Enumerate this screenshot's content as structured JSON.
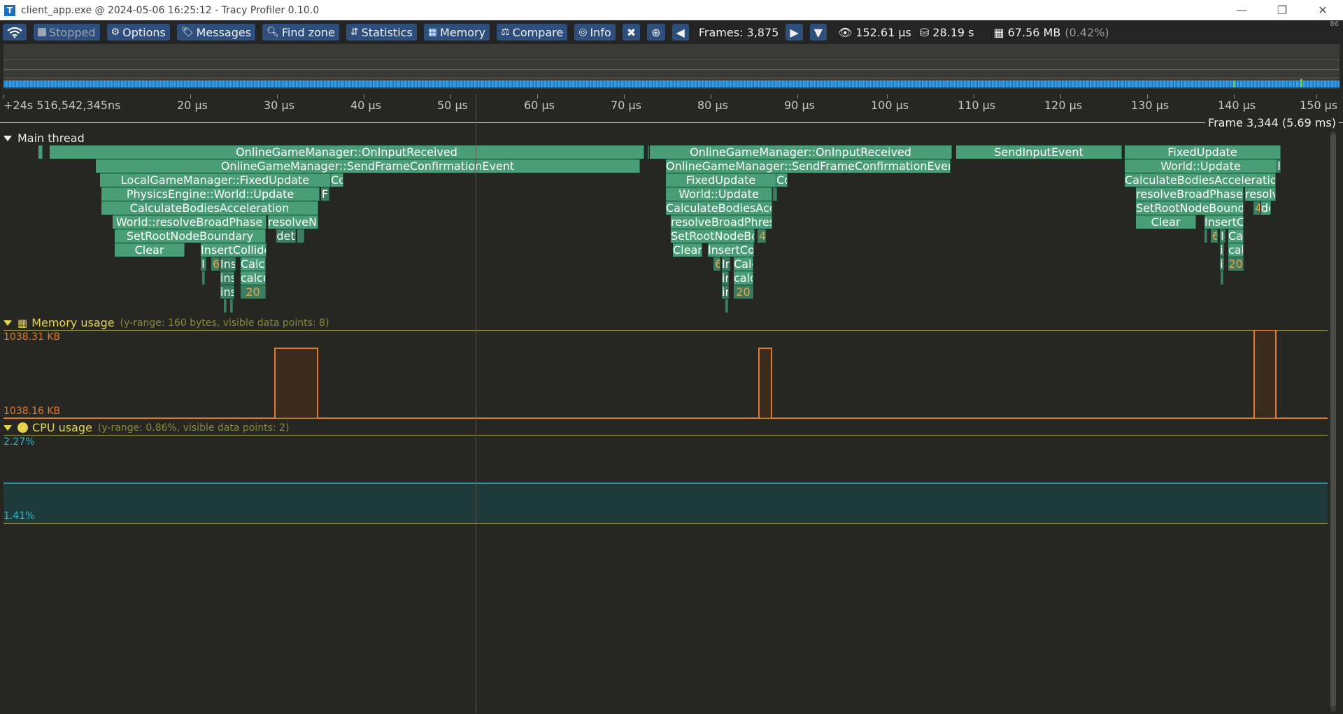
{
  "window": {
    "title": "client_app.exe @ 2024-05-06 16:25:12 - Tracy Profiler 0.10.0",
    "app_icon": "T",
    "controls": [
      "minimize",
      "maximize",
      "close"
    ]
  },
  "toolbar": {
    "connection_icon": "wifi-icon",
    "stopped_label": "Stopped",
    "options_label": "Options",
    "messages_label": "Messages",
    "find_zone_label": "Find zone",
    "statistics_label": "Statistics",
    "memory_label": "Memory",
    "compare_label": "Compare",
    "info_label": "Info",
    "frames_label": "Frames: 3,875",
    "view_time": "152.61 μs",
    "total_time": "28.19 s",
    "memory_used": "67.56 MB",
    "memory_pct": "(0.42%)",
    "corner_number": "86"
  },
  "timeline": {
    "ticks": [
      "+24s 516,542,345ns",
      "20 μs",
      "30 μs",
      "40 μs",
      "50 μs",
      "60 μs",
      "70 μs",
      "80 μs",
      "90 μs",
      "100 μs",
      "110 μs",
      "120 μs",
      "130 μs",
      "140 μs",
      "150 μs"
    ],
    "frame_label": "Frame 3,344 (5.69 ms)"
  },
  "main_thread": {
    "label": "Main thread",
    "zones": [
      "OnlineGameManager::OnInputReceived",
      "OnlineGameManager::SendFrameConfirmationEvent",
      "LocalGameManager::FixedUpdate",
      "PhysicsEngine::World::Update",
      "CalculateBodiesAcceleration",
      "World::resolveBroadPhase",
      "SetRootNodeBoundary",
      "Clear",
      "InsertCollide",
      "resolveNa",
      "det",
      "Co",
      "F",
      "I",
      "6",
      "Ins",
      "ins",
      "ins",
      "Calcu",
      "calcu",
      "20",
      "OnlineGameManager::OnInputReceived",
      "OnlineGameManager::SendFrameConfirmationEvent",
      "FixedUpdate",
      "World::Update",
      "CalculateBodiesAcce",
      "resolveBroadPhres",
      "SetRootNodeBo",
      "Clear",
      "InsertCo",
      "Co",
      "4",
      "6",
      "Ir",
      "ir",
      "ir",
      "Calc",
      "calc",
      "20",
      "SendInputEvent",
      "FixedUpdate",
      "World::Update",
      "CalculateBodiesAcceleration",
      "resolveBroadPhase",
      "resolv",
      "SetRootNodeBounda",
      "4",
      "de",
      "Clear",
      "InsertC",
      "6",
      "I",
      "i",
      "i",
      "Cal",
      "cal",
      "20",
      "F"
    ]
  },
  "memory_usage": {
    "label": "Memory usage",
    "range": "(y-range: 160 bytes, visible data points: 8)",
    "max_label": "1038.31 KB",
    "min_label": "1038.16 KB",
    "icon": "memory-icon",
    "color": "#e07a2a"
  },
  "cpu_usage": {
    "label": "CPU usage",
    "range": "(y-range: 0.86%, visible data points: 2)",
    "max_label": "2.27%",
    "min_label": "1.41%",
    "icon": "gauge-icon",
    "color": "#2fb7c7"
  }
}
